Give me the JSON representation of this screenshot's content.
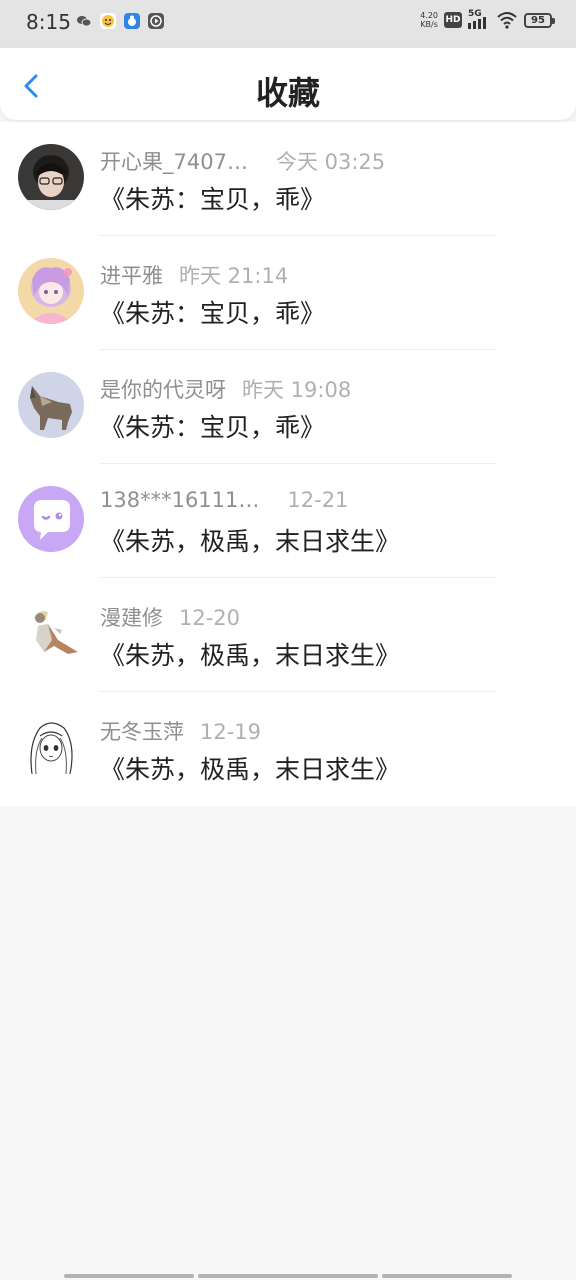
{
  "status_bar": {
    "time": "8:15",
    "net_speed_value": "4.20",
    "net_speed_unit": "KB/s",
    "hd": "HD",
    "network": "5G",
    "battery": "95",
    "app_icons": [
      "wechat-icon",
      "emoji-app-icon",
      "bug-app-icon",
      "video-app-icon"
    ]
  },
  "header": {
    "title": "收藏",
    "back_icon": "chevron-left-icon",
    "accent_color": "#2d8cf0"
  },
  "favorites": [
    {
      "username": "开心果_7407…",
      "time": "今天 03:25",
      "title": "《朱苏：宝贝，乖》",
      "avatar": "avatar-boy-photo"
    },
    {
      "username": "进平雅",
      "time": "昨天 21:14",
      "title": "《朱苏：宝贝，乖》",
      "avatar": "avatar-anime-girl-pink"
    },
    {
      "username": "是你的代灵呀",
      "time": "昨天 19:08",
      "title": "《朱苏：宝贝，乖》",
      "avatar": "avatar-wolf"
    },
    {
      "username": "138***16111…",
      "time": "12-21",
      "title": "《朱苏，极禹，末日求生》",
      "avatar": "avatar-default-chat-bubble"
    },
    {
      "username": "漫建修",
      "time": "12-20",
      "title": "《朱苏，极禹，末日求生》",
      "avatar": "avatar-anime-character"
    },
    {
      "username": "无冬玉萍",
      "time": "12-19",
      "title": "《朱苏，极禹，末日求生》",
      "avatar": "avatar-sketch-girl"
    }
  ]
}
